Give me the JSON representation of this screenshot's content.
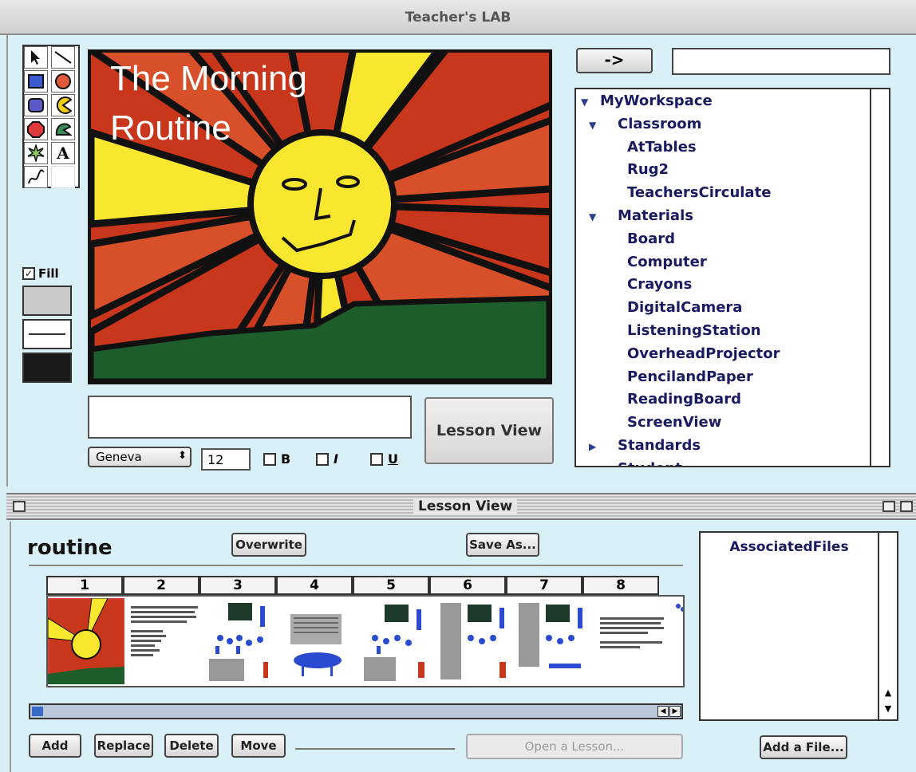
{
  "window": {
    "title": "Teacher's LAB"
  },
  "toolbox": {
    "fill_label": "Fill",
    "text_tool_glyph": "A"
  },
  "canvas": {
    "title_line1": "The Morning",
    "title_line2": "Routine"
  },
  "editor": {
    "lesson_view_button": "Lesson View",
    "font_name": "Geneva",
    "font_size": "12",
    "bold_label": "B",
    "italic_label": "I",
    "underline_label": "U"
  },
  "nav": {
    "go_button": "->"
  },
  "tree": {
    "items": [
      {
        "label": "MyWorkspace",
        "level": 0,
        "expanded": true
      },
      {
        "label": "Classroom",
        "level": 1,
        "expanded": true
      },
      {
        "label": "AtTables",
        "level": 2
      },
      {
        "label": "Rug2",
        "level": 2
      },
      {
        "label": "TeachersCirculate",
        "level": 2
      },
      {
        "label": "Materials",
        "level": 1,
        "expanded": true
      },
      {
        "label": "Board",
        "level": 2
      },
      {
        "label": "Computer",
        "level": 2
      },
      {
        "label": "Crayons",
        "level": 2
      },
      {
        "label": "DigitalCamera",
        "level": 2
      },
      {
        "label": "ListeningStation",
        "level": 2
      },
      {
        "label": "OverheadProjector",
        "level": 2
      },
      {
        "label": "PencilandPaper",
        "level": 2
      },
      {
        "label": "ReadingBoard",
        "level": 2
      },
      {
        "label": "ScreenView",
        "level": 2
      },
      {
        "label": "Standards",
        "level": 1,
        "expanded": false
      },
      {
        "label": "Student",
        "level": 1
      }
    ]
  },
  "lesson_view": {
    "title": "Lesson View",
    "lesson_name": "routine",
    "overwrite_button": "Overwrite",
    "save_as_button": "Save As...",
    "slide_numbers": [
      "1",
      "2",
      "3",
      "4",
      "5",
      "6",
      "7",
      "8"
    ],
    "associated_files_header": "AssociatedFiles",
    "add_button": "Add",
    "replace_button": "Replace",
    "delete_button": "Delete",
    "move_button": "Move",
    "open_lesson_button": "Open a Lesson...",
    "add_file_button": "Add a File..."
  },
  "colors": {
    "sun_yellow": "#f9e62e",
    "ray_red": "#c8361c",
    "ray_orange": "#d8502a",
    "grass_green": "#1e5e2c",
    "window_bg": "#d9f0f6"
  }
}
